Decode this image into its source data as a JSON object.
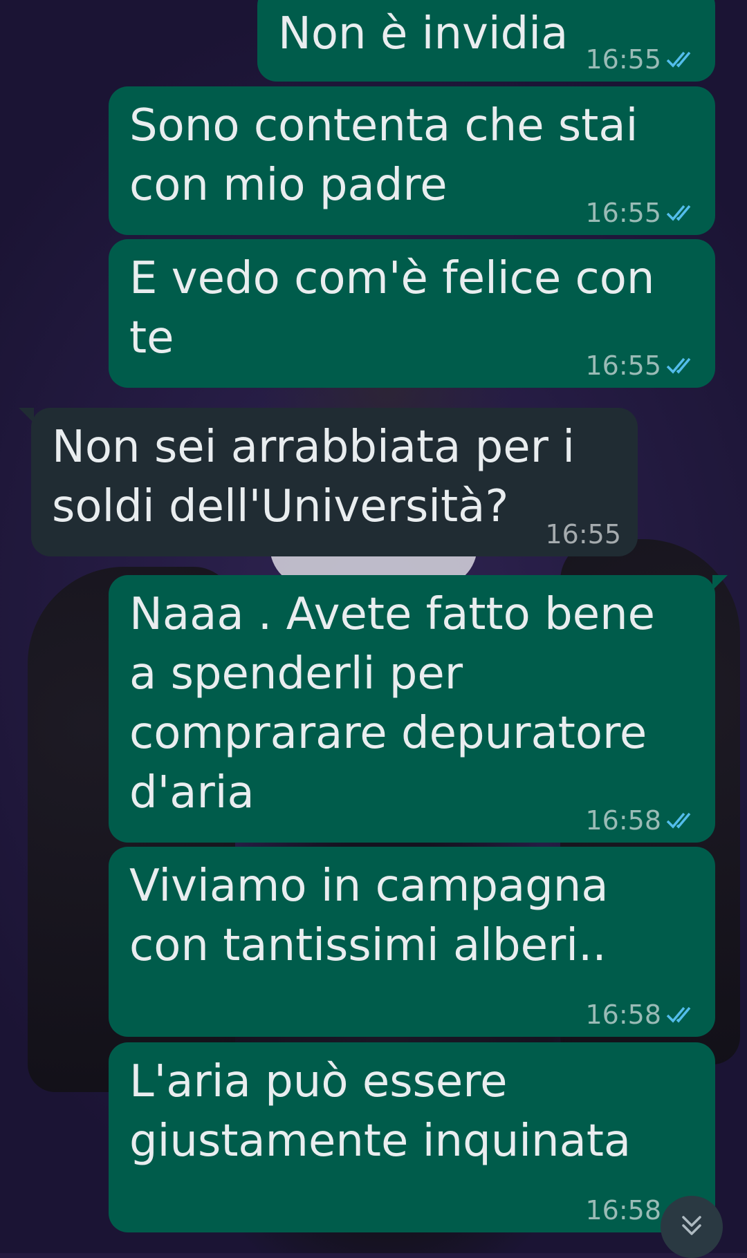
{
  "colors": {
    "outgoing_bubble": "#005c4b",
    "incoming_bubble": "#202c33",
    "read_ticks": "#53bdeb",
    "wallpaper": "#241a3f"
  },
  "messages": [
    {
      "direction": "out",
      "text": "Non è invidia",
      "time": "16:55",
      "status_icon": "double-check-read-icon"
    },
    {
      "direction": "out",
      "text": "Sono contenta che stai con mio padre",
      "time": "16:55",
      "status_icon": "double-check-read-icon"
    },
    {
      "direction": "out",
      "text": "E vedo com'è felice con te",
      "time": "16:55",
      "status_icon": "double-check-read-icon"
    },
    {
      "direction": "in",
      "text": "Non sei arrabbiata per i soldi dell'Università?",
      "time": "16:55"
    },
    {
      "direction": "out",
      "text": "Naaa . Avete fatto bene a spenderli per comprarare depuratore d'aria",
      "time": "16:58",
      "status_icon": "double-check-read-icon"
    },
    {
      "direction": "out",
      "text": "Viviamo in campagna con tantissimi alberi..",
      "time": "16:58",
      "status_icon": "double-check-read-icon"
    },
    {
      "direction": "out",
      "text": "L'aria può essere giustamente inquinata",
      "time": "16:58",
      "status_icon": "double-check-read-icon"
    }
  ],
  "scroll_down_button": {
    "icon": "double-chevron-down-icon"
  }
}
